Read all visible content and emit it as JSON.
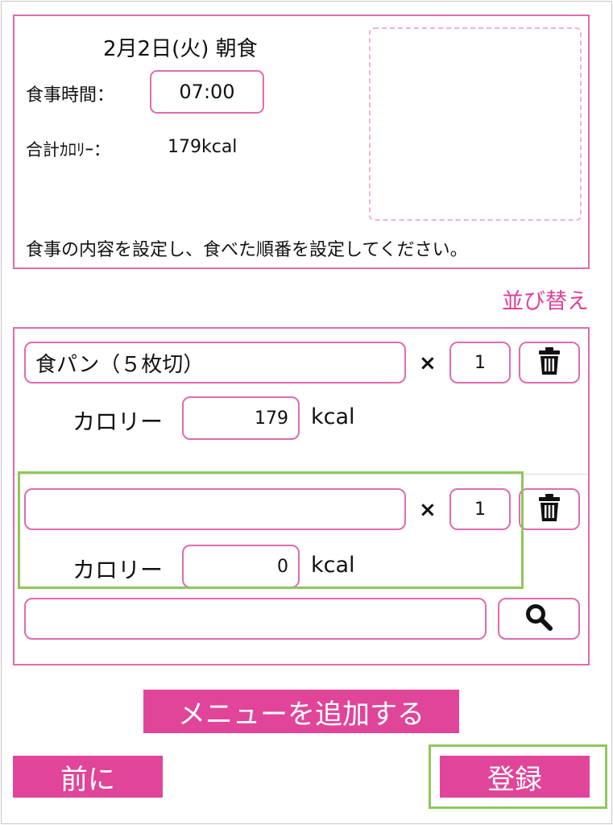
{
  "header": {
    "meal_title": "2月2日(火) 朝食",
    "time_label": "食事時間：",
    "time_value": "07:00",
    "calorie_label": "合計ｶﾛﾘｰ：",
    "calorie_total": "179kcal",
    "instruction": "食事の内容を設定し、食べた順番を設定してください。"
  },
  "sort_label": "並び替え",
  "items": [
    {
      "name": "食パン（５枚切）",
      "times": "×",
      "qty": "1",
      "calorie_label": "カロリー",
      "calorie": "179",
      "unit": "kcal"
    },
    {
      "name": "",
      "times": "×",
      "qty": "1",
      "calorie_label": "カロリー",
      "calorie": "0",
      "unit": "kcal"
    }
  ],
  "search": {
    "value": ""
  },
  "buttons": {
    "add_menu": "メニューを追加する",
    "prev": "前に",
    "register": "登録"
  },
  "icons": {
    "delete": "trash-icon",
    "search": "search-icon"
  },
  "colors": {
    "accent": "#e0459a",
    "border": "#e06bb0",
    "highlight": "#8fc85a"
  }
}
